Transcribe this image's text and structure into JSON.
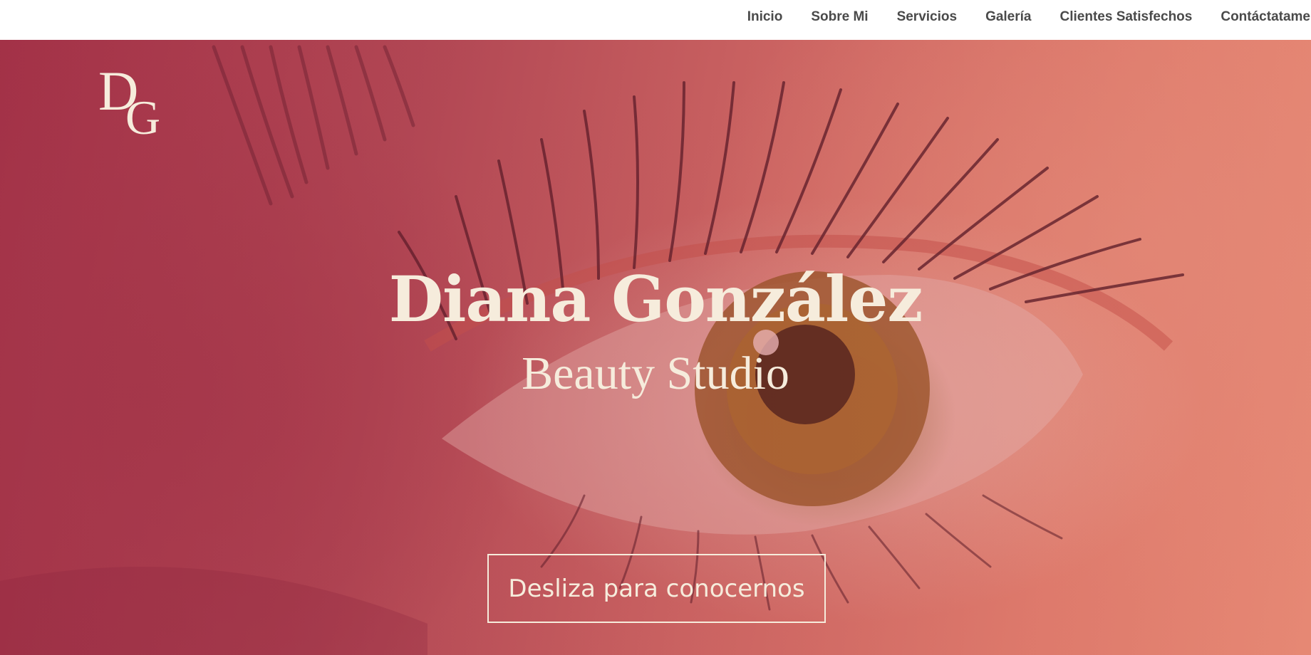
{
  "nav": {
    "items": [
      {
        "label": "Inicio"
      },
      {
        "label": "Sobre Mi"
      },
      {
        "label": "Servicios"
      },
      {
        "label": "Galería"
      },
      {
        "label": "Clientes Satisfechos"
      },
      {
        "label": "Contáctatame"
      }
    ]
  },
  "logo": {
    "text": "DG"
  },
  "hero": {
    "title": "Diana González",
    "subtitle": "Beauty Studio",
    "cta_label": "Desliza para conocernos"
  },
  "colors": {
    "cream": "#f6ecdc",
    "nav_text": "#4a4a4a",
    "hero_deep": "#a7384b",
    "hero_light": "#e68a76"
  }
}
